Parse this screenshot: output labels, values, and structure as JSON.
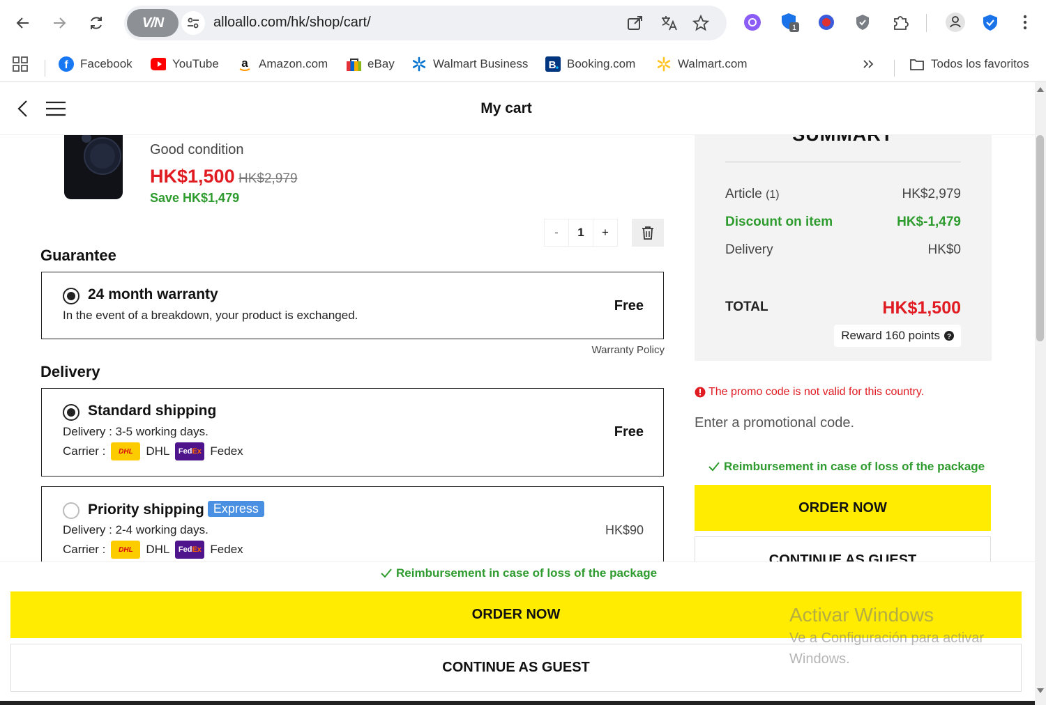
{
  "browser": {
    "url": "alloallo.com/hk/shop/cart/",
    "vpn_label": "V/N",
    "extension_badge": "1",
    "bookmarks": [
      {
        "label": "Facebook",
        "icon": "facebook-icon"
      },
      {
        "label": "YouTube",
        "icon": "youtube-icon"
      },
      {
        "label": "Amazon.com",
        "icon": "amazon-icon"
      },
      {
        "label": "eBay",
        "icon": "ebay-icon"
      },
      {
        "label": "Walmart Business",
        "icon": "walmart-icon"
      },
      {
        "label": "Booking.com",
        "icon": "booking-icon"
      },
      {
        "label": "Walmart.com",
        "icon": "walmart-icon"
      }
    ],
    "all_bookmarks_label": "Todos los favoritos"
  },
  "header": {
    "title": "My cart"
  },
  "product": {
    "condition": "Good condition",
    "price": "HK$1,500",
    "old_price": "HK$2,979",
    "saving": "Save HK$1,479",
    "quantity": "1",
    "qty_minus": "-",
    "qty_plus": "+"
  },
  "guarantee": {
    "heading": "Guarantee",
    "option_title": "24 month warranty",
    "option_desc": "In the event of a breakdown, your product is exchanged.",
    "option_price": "Free",
    "policy_link": "Warranty Policy"
  },
  "delivery": {
    "heading": "Delivery",
    "carrier_label": "Carrier :",
    "carriers": [
      "DHL",
      "Fedex"
    ],
    "options": [
      {
        "title": "Standard shipping",
        "desc": "Delivery : 3-5 working days.",
        "price": "Free",
        "selected": true
      },
      {
        "title": "Priority shipping",
        "badge": "Express",
        "desc": "Delivery : 2-4 working days.",
        "price": "HK$90",
        "selected": false
      }
    ]
  },
  "summary": {
    "title": "SUMMARY",
    "article_label": "Article",
    "article_count": "(1)",
    "article_value": "HK$2,979",
    "discount_label": "Discount on item",
    "discount_value": "HK$-1,479",
    "delivery_label": "Delivery",
    "delivery_value": "HK$0",
    "total_label": "TOTAL",
    "total_value": "HK$1,500",
    "reward": "Reward 160 points"
  },
  "promo": {
    "error": "The promo code is not valid for this country.",
    "placeholder": "Enter a promotional code."
  },
  "actions": {
    "reimbursement": "Reimbursement in case of loss of the package",
    "order_now": "ORDER NOW",
    "continue_guest": "CONTINUE AS GUEST"
  },
  "windows_watermark": {
    "title": "Activar Windows",
    "subtitle_1": "Ve a Configuración para activar",
    "subtitle_2": "Windows."
  },
  "colors": {
    "accent_yellow": "#ffec00",
    "price_red": "#e01b22",
    "success_green": "#2d9b2d",
    "express_blue": "#4a90e2"
  }
}
